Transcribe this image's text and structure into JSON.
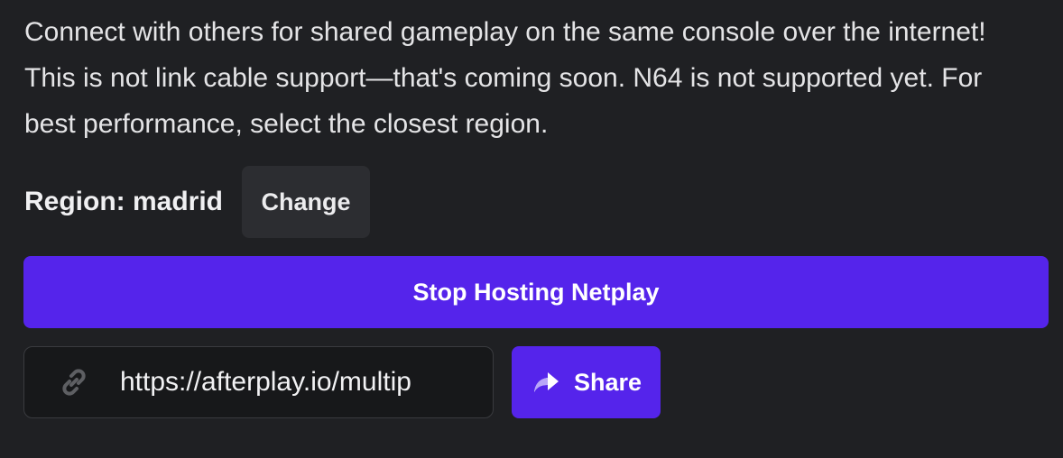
{
  "description": "Connect with others for shared gameplay on the same console over the internet! This is not link cable support—that's coming soon. N64 is not supported yet. For best performance, select the closest region.",
  "region": {
    "label": "Region: madrid",
    "change_label": "Change"
  },
  "netplay": {
    "stop_label": "Stop Hosting Netplay"
  },
  "share_link": {
    "icon": "link-icon",
    "url": "https://afterplay.io/multip",
    "share_icon": "share-arrow-icon",
    "share_label": "Share"
  },
  "colors": {
    "background": "#1f2023",
    "accent": "#5524eb",
    "secondary_button": "#2c2d31",
    "input_background": "#17181a"
  }
}
